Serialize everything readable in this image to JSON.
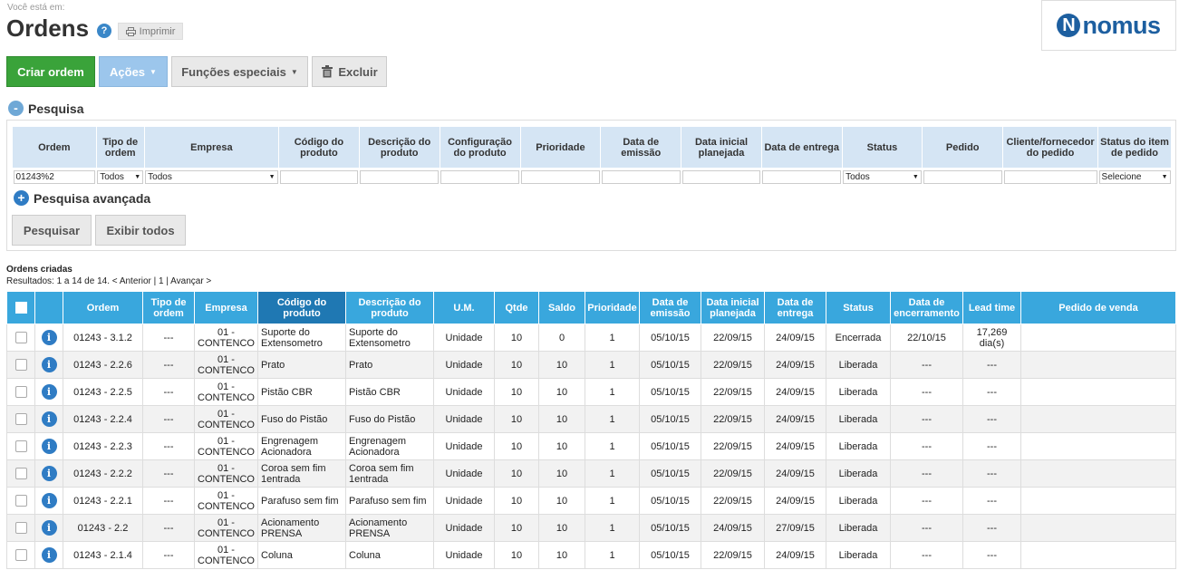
{
  "breadcrumb": "Você está em:",
  "page_title": "Ordens",
  "help_icon": "?",
  "print_label": "Imprimir",
  "logo": {
    "mark": "N",
    "text": "nomus"
  },
  "toolbar": {
    "create": "Criar ordem",
    "actions": "Ações",
    "special": "Funções especiais",
    "delete": "Excluir"
  },
  "search": {
    "title": "Pesquisa",
    "advanced": "Pesquisa avançada",
    "search_btn": "Pesquisar",
    "show_all_btn": "Exibir todos",
    "columns": [
      "Ordem",
      "Tipo de ordem",
      "Empresa",
      "Código do produto",
      "Descrição do produto",
      "Configuração do produto",
      "Prioridade",
      "Data de emissão",
      "Data inicial planejada",
      "Data de entrega",
      "Status",
      "Pedido",
      "Cliente/fornecedor do pedido",
      "Status do item de pedido"
    ],
    "values": {
      "ordem": "01243%2",
      "tipo": "Todos",
      "empresa": "Todos",
      "status": "Todos",
      "status_item": "Selecione"
    }
  },
  "results": {
    "title": "Ordens criadas",
    "info": "Resultados: 1 a 14 de 14. < Anterior | 1 | Avançar >",
    "columns": [
      "Ordem",
      "Tipo de ordem",
      "Empresa",
      "Código do produto",
      "Descrição do produto",
      "U.M.",
      "Qtde",
      "Saldo",
      "Prioridade",
      "Data de emissão",
      "Data inicial planejada",
      "Data de entrega",
      "Status",
      "Data de encerramento",
      "Lead time",
      "Pedido de venda"
    ],
    "rows": [
      {
        "ordem": "01243 - 3.1.2",
        "tipo": "---",
        "empresa": "01 - CONTENCO",
        "codigo": "Suporte do Extensometro",
        "descricao": "Suporte do Extensometro",
        "um": "Unidade",
        "qtde": "10",
        "saldo": "0",
        "prioridade": "1",
        "emissao": "05/10/15",
        "inicial": "22/09/15",
        "entrega": "24/09/15",
        "status": "Encerrada",
        "encerramento": "22/10/15",
        "lead": "17,269 dia(s)",
        "pedido": ""
      },
      {
        "ordem": "01243 - 2.2.6",
        "tipo": "---",
        "empresa": "01 - CONTENCO",
        "codigo": "Prato",
        "descricao": "Prato",
        "um": "Unidade",
        "qtde": "10",
        "saldo": "10",
        "prioridade": "1",
        "emissao": "05/10/15",
        "inicial": "22/09/15",
        "entrega": "24/09/15",
        "status": "Liberada",
        "encerramento": "---",
        "lead": "---",
        "pedido": ""
      },
      {
        "ordem": "01243 - 2.2.5",
        "tipo": "---",
        "empresa": "01 - CONTENCO",
        "codigo": "Pistão CBR",
        "descricao": "Pistão CBR",
        "um": "Unidade",
        "qtde": "10",
        "saldo": "10",
        "prioridade": "1",
        "emissao": "05/10/15",
        "inicial": "22/09/15",
        "entrega": "24/09/15",
        "status": "Liberada",
        "encerramento": "---",
        "lead": "---",
        "pedido": ""
      },
      {
        "ordem": "01243 - 2.2.4",
        "tipo": "---",
        "empresa": "01 - CONTENCO",
        "codigo": "Fuso do Pistão",
        "descricao": "Fuso do Pistão",
        "um": "Unidade",
        "qtde": "10",
        "saldo": "10",
        "prioridade": "1",
        "emissao": "05/10/15",
        "inicial": "22/09/15",
        "entrega": "24/09/15",
        "status": "Liberada",
        "encerramento": "---",
        "lead": "---",
        "pedido": ""
      },
      {
        "ordem": "01243 - 2.2.3",
        "tipo": "---",
        "empresa": "01 - CONTENCO",
        "codigo": "Engrenagem Acionadora",
        "descricao": "Engrenagem Acionadora",
        "um": "Unidade",
        "qtde": "10",
        "saldo": "10",
        "prioridade": "1",
        "emissao": "05/10/15",
        "inicial": "22/09/15",
        "entrega": "24/09/15",
        "status": "Liberada",
        "encerramento": "---",
        "lead": "---",
        "pedido": ""
      },
      {
        "ordem": "01243 - 2.2.2",
        "tipo": "---",
        "empresa": "01 - CONTENCO",
        "codigo": "Coroa sem fim 1entrada",
        "descricao": "Coroa sem fim 1entrada",
        "um": "Unidade",
        "qtde": "10",
        "saldo": "10",
        "prioridade": "1",
        "emissao": "05/10/15",
        "inicial": "22/09/15",
        "entrega": "24/09/15",
        "status": "Liberada",
        "encerramento": "---",
        "lead": "---",
        "pedido": ""
      },
      {
        "ordem": "01243 - 2.2.1",
        "tipo": "---",
        "empresa": "01 - CONTENCO",
        "codigo": "Parafuso sem fim",
        "descricao": "Parafuso sem fim",
        "um": "Unidade",
        "qtde": "10",
        "saldo": "10",
        "prioridade": "1",
        "emissao": "05/10/15",
        "inicial": "22/09/15",
        "entrega": "24/09/15",
        "status": "Liberada",
        "encerramento": "---",
        "lead": "---",
        "pedido": ""
      },
      {
        "ordem": "01243 - 2.2",
        "tipo": "---",
        "empresa": "01 - CONTENCO",
        "codigo": "Acionamento PRENSA",
        "descricao": "Acionamento PRENSA",
        "um": "Unidade",
        "qtde": "10",
        "saldo": "10",
        "prioridade": "1",
        "emissao": "05/10/15",
        "inicial": "24/09/15",
        "entrega": "27/09/15",
        "status": "Liberada",
        "encerramento": "---",
        "lead": "---",
        "pedido": ""
      },
      {
        "ordem": "01243 - 2.1.4",
        "tipo": "---",
        "empresa": "01 - CONTENCO",
        "codigo": "Coluna",
        "descricao": "Coluna",
        "um": "Unidade",
        "qtde": "10",
        "saldo": "10",
        "prioridade": "1",
        "emissao": "05/10/15",
        "inicial": "22/09/15",
        "entrega": "24/09/15",
        "status": "Liberada",
        "encerramento": "---",
        "lead": "---",
        "pedido": ""
      }
    ]
  }
}
